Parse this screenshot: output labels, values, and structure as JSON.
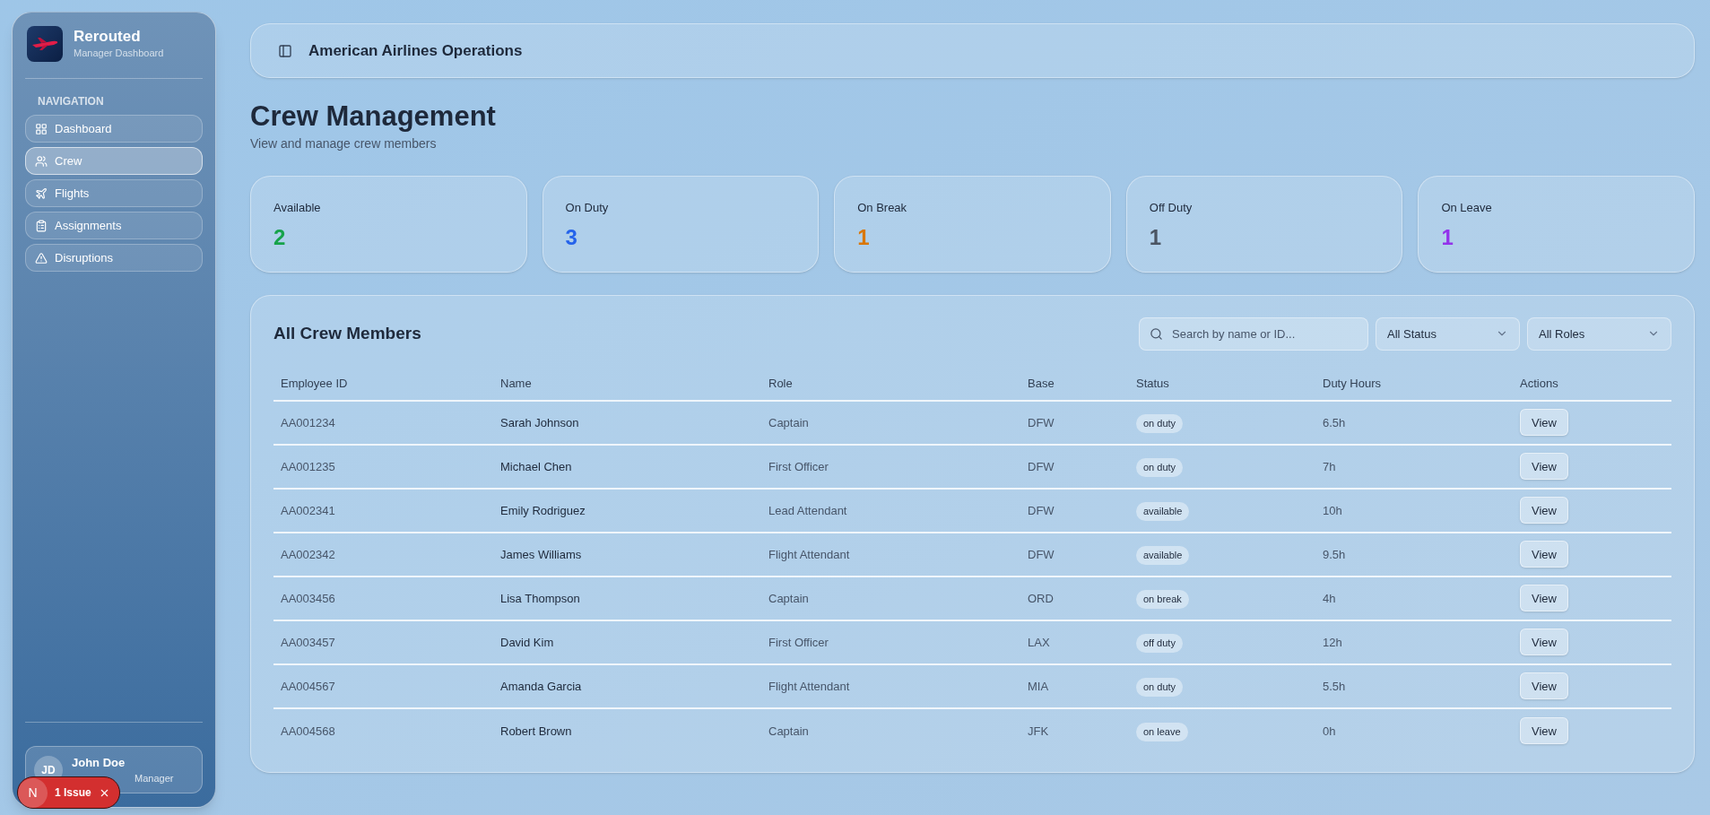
{
  "brand": {
    "name": "Rerouted",
    "subtitle": "Manager Dashboard"
  },
  "nav_heading": "NAVIGATION",
  "nav": [
    {
      "label": "Dashboard",
      "selected": false
    },
    {
      "label": "Crew",
      "selected": true
    },
    {
      "label": "Flights",
      "selected": false
    },
    {
      "label": "Assignments",
      "selected": false
    },
    {
      "label": "Disruptions",
      "selected": false
    }
  ],
  "user": {
    "initials": "JD",
    "name": "John Doe",
    "role": "Manager"
  },
  "issue_toast": {
    "letter": "N",
    "label": "1 Issue"
  },
  "header": {
    "title": "American Airlines Operations"
  },
  "page": {
    "title": "Crew Management",
    "subtitle": "View and manage crew members"
  },
  "stats": [
    {
      "label": "Available",
      "value": "2",
      "color": "#16a34a"
    },
    {
      "label": "On Duty",
      "value": "3",
      "color": "#2563eb"
    },
    {
      "label": "On Break",
      "value": "1",
      "color": "#d97706"
    },
    {
      "label": "Off Duty",
      "value": "1",
      "color": "#4b5563"
    },
    {
      "label": "On Leave",
      "value": "1",
      "color": "#9333ea"
    }
  ],
  "table": {
    "title": "All Crew Members",
    "search": {
      "placeholder": "Search by name or ID..."
    },
    "filters": [
      "All Status",
      "All Roles"
    ],
    "columns": [
      "Employee ID",
      "Name",
      "Role",
      "Base",
      "Status",
      "Duty Hours",
      "Actions"
    ],
    "rows": [
      {
        "id": "AA001234",
        "name": "Sarah Johnson",
        "role": "Captain",
        "base": "DFW",
        "status": "on duty",
        "hours": "6.5h",
        "action": "View"
      },
      {
        "id": "AA001235",
        "name": "Michael Chen",
        "role": "First Officer",
        "base": "DFW",
        "status": "on duty",
        "hours": "7h",
        "action": "View"
      },
      {
        "id": "AA002341",
        "name": "Emily Rodriguez",
        "role": "Lead Attendant",
        "base": "DFW",
        "status": "available",
        "hours": "10h",
        "action": "View"
      },
      {
        "id": "AA002342",
        "name": "James Williams",
        "role": "Flight Attendant",
        "base": "DFW",
        "status": "available",
        "hours": "9.5h",
        "action": "View"
      },
      {
        "id": "AA003456",
        "name": "Lisa Thompson",
        "role": "Captain",
        "base": "ORD",
        "status": "on break",
        "hours": "4h",
        "action": "View"
      },
      {
        "id": "AA003457",
        "name": "David Kim",
        "role": "First Officer",
        "base": "LAX",
        "status": "off duty",
        "hours": "12h",
        "action": "View"
      },
      {
        "id": "AA004567",
        "name": "Amanda Garcia",
        "role": "Flight Attendant",
        "base": "MIA",
        "status": "on duty",
        "hours": "5.5h",
        "action": "View"
      },
      {
        "id": "AA004568",
        "name": "Robert Brown",
        "role": "Captain",
        "base": "JFK",
        "status": "on leave",
        "hours": "0h",
        "action": "View"
      }
    ]
  }
}
